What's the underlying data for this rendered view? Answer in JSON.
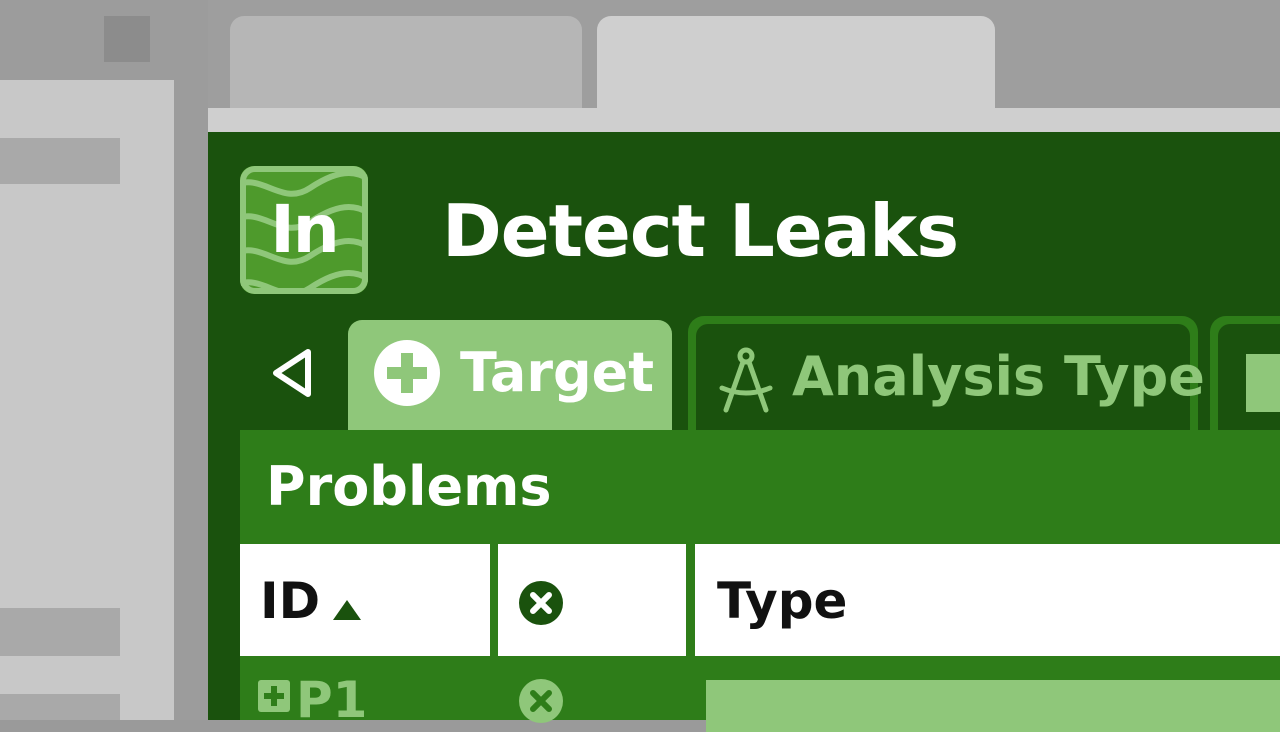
{
  "app": {
    "icon_label": "In",
    "window_title": "Detect Leaks"
  },
  "tabs": [
    {
      "label": "Target",
      "icon": "plus-circle-icon",
      "active": true
    },
    {
      "label": "Analysis Type",
      "icon": "compass-icon",
      "active": false
    }
  ],
  "problems": {
    "title": "Problems",
    "columns": [
      {
        "label": "ID",
        "sort": "ascending"
      },
      {
        "label": "",
        "icon": "close-circle-icon"
      },
      {
        "label": "Type"
      }
    ],
    "rows": [
      {
        "id": "P1",
        "status_icon": "close-circle-icon"
      }
    ]
  },
  "colors": {
    "window_dark_green": "#1a520d",
    "panel_green": "#2e7d19",
    "accent_light_green": "#8fc77a",
    "icon_green": "#4e9a2c"
  }
}
